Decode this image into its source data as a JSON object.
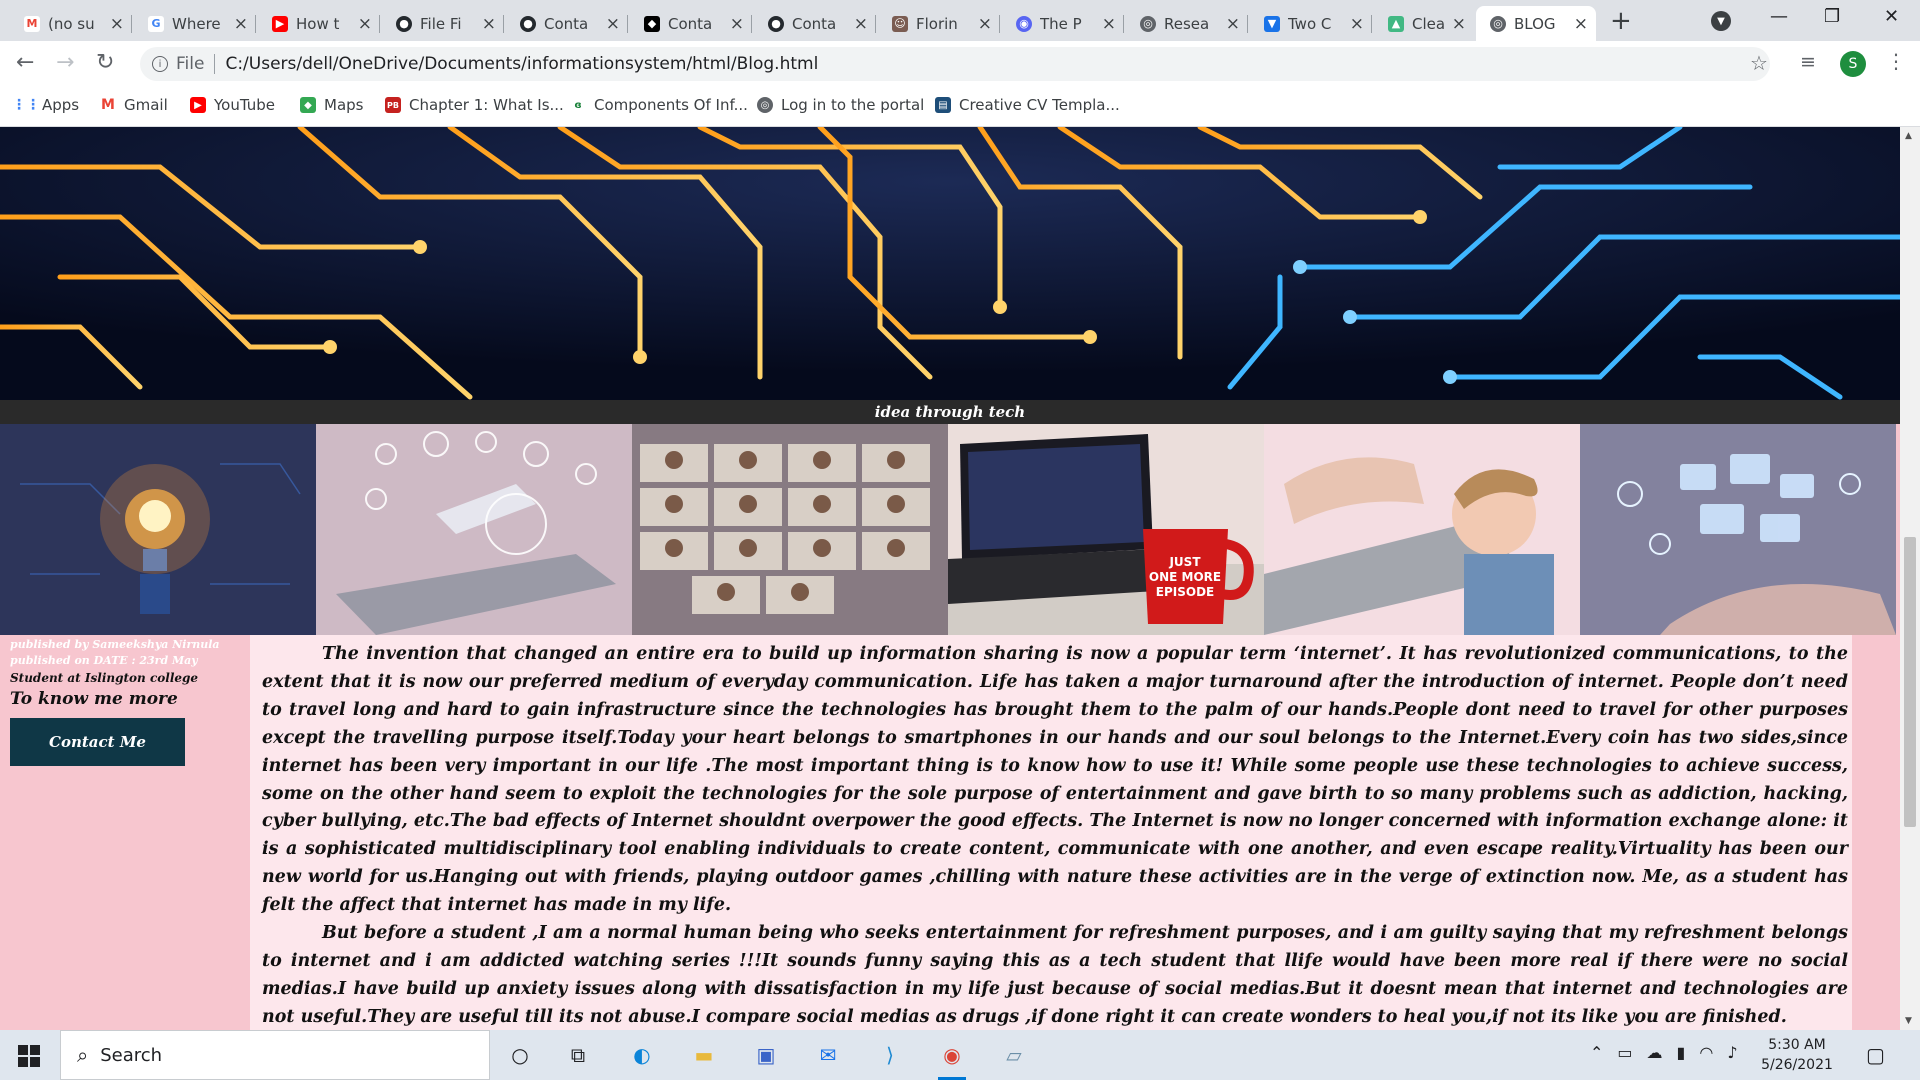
{
  "browser": {
    "tabs": [
      {
        "title": "(no su",
        "favicon": "gmail-icon",
        "color": "#ea4335"
      },
      {
        "title": "Where",
        "favicon": "google-icon",
        "color": "#4285f4"
      },
      {
        "title": "How t",
        "favicon": "youtube-icon",
        "color": "#ff0000"
      },
      {
        "title": "File Fi",
        "favicon": "github-icon",
        "color": "#24292e"
      },
      {
        "title": "Conta",
        "favicon": "github-icon",
        "color": "#24292e"
      },
      {
        "title": "Conta",
        "favicon": "codepen-icon",
        "color": "#000000"
      },
      {
        "title": "Conta",
        "favicon": "github-icon",
        "color": "#24292e"
      },
      {
        "title": "Florin",
        "favicon": "person-icon",
        "color": "#7a5c52"
      },
      {
        "title": "The P",
        "favicon": "discord-icon",
        "color": "#5865f2"
      },
      {
        "title": "Resea",
        "favicon": "globe-icon",
        "color": "#5f6368"
      },
      {
        "title": "Two C",
        "favicon": "bookmark-icon",
        "color": "#1a73e8"
      },
      {
        "title": "Clean",
        "favicon": "vue-icon",
        "color": "#41b883"
      },
      {
        "title": "BLOG",
        "favicon": "globe-icon",
        "color": "#5f6368",
        "active": true
      }
    ],
    "url_scheme": "File",
    "url": "C:/Users/dell/OneDrive/Documents/informationsystem/html/Blog.html",
    "profile_initial": "S",
    "bookmarks": [
      {
        "label": "Apps",
        "icon": "apps-grid-icon",
        "color": "#4285f4"
      },
      {
        "label": "Gmail",
        "icon": "gmail-icon",
        "color": "#ea4335"
      },
      {
        "label": "YouTube",
        "icon": "youtube-icon",
        "color": "#ff0000"
      },
      {
        "label": "Maps",
        "icon": "maps-icon",
        "color": "#34a853"
      },
      {
        "label": "Chapter 1: What Is...",
        "icon": "pb-icon",
        "color": "#c5221f"
      },
      {
        "label": "Components Of Inf...",
        "icon": "ge-icon",
        "color": "#188038"
      },
      {
        "label": "Log in to the portal",
        "icon": "globe-icon",
        "color": "#5f6368"
      },
      {
        "label": "Creative CV Templa...",
        "icon": "doc-icon",
        "color": "#1e4e79"
      }
    ]
  },
  "page": {
    "tagline": "idea through tech",
    "sidebar": {
      "published_by": "published by Sameekshya Nirnula",
      "published_on": "published on DATE : 23rd May",
      "student": "Student at Islington college",
      "know_more": "To know me more",
      "contact_button": "Contact Me"
    },
    "article": {
      "paragraph1": "The invention that changed an entire era to build up information sharing is now a popular term ‘internet’. It has revolutionized communications, to the extent that it is now our preferred medium of everyday communication. Life has taken a major turnaround after the introduction of internet. People don’t need to travel long and hard to gain infrastructure since the technologies has brought them to the palm of our hands.People dont need to travel for other purposes except the travelling purpose itself.Today your heart belongs to smartphones in our hands and our soul belongs to the Internet.Every coin has two sides,since internet has been very important in our life .The most important thing is to know how to use it! While some people use these technologies to achieve success, some on the other hand seem to exploit the technologies for the sole purpose of entertainment and gave birth to so many problems such as addiction, hacking, cyber bullying, etc.The bad effects of Internet shouldnt overpower the good effects. The Internet is now no longer concerned with information exchange alone: it is a sophisticated multidisciplinary tool enabling individuals to create content, communicate with one another, and even escape reality.Virtuality has been our new world for us.Hanging out with friends, playing outdoor games ,chilling with nature these activities are in the verge of extinction now. Me, as a student has felt the affect that internet has made in my life.",
      "paragraph2": "But before a student ,I am a normal human being who seeks entertainment for refreshment purposes, and i am guilty saying that my refreshment belongs to internet and i am addicted watching series !!!It sounds funny saying this as a tech student that llife would have been more real if there were no social medias.I have build up anxiety issues along with dissatisfaction in my life just because of social medias.But it doesnt mean that internet and technologies are not useful.They are useful till its not abuse.I compare social medias as drugs ,if done right it can create wonders to heal you,if not its like you are finished."
    },
    "gallery_images": [
      {
        "subject": "lightbulb-circuit"
      },
      {
        "subject": "laptop-phone-icons"
      },
      {
        "subject": "video-call-grid"
      },
      {
        "subject": "laptop-mug",
        "mug_text": "JUST ONE MORE EPISODE"
      },
      {
        "subject": "boy-laptop"
      },
      {
        "subject": "hand-tech-hologram"
      }
    ]
  },
  "taskbar": {
    "search_placeholder": "Search",
    "time": "5:30 AM",
    "date": "5/26/2021"
  }
}
